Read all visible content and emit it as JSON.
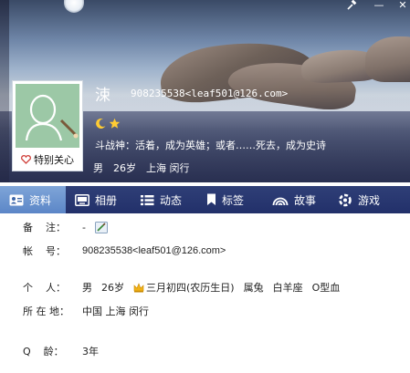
{
  "window": {
    "controls": {
      "tool_icon": "hammer-icon",
      "minimize_label": "—",
      "close_label": "✕"
    }
  },
  "profile": {
    "nickname": "涑",
    "qq_id": "908235538<leaf501@126.com>",
    "care_label": "特别关心",
    "signature": "斗战神：活着，成为英雄；或者……死去，成为史诗",
    "gender": "男",
    "age": "26岁",
    "location": "上海 闵行",
    "level_icons": [
      "moon-icon",
      "star-icon"
    ]
  },
  "tabs": [
    {
      "label": "资料",
      "icon": "profile-card-icon",
      "active": true
    },
    {
      "label": "相册",
      "icon": "album-icon",
      "active": false
    },
    {
      "label": "动态",
      "icon": "feed-list-icon",
      "active": false
    },
    {
      "label": "标签",
      "icon": "bookmark-icon",
      "active": false
    },
    {
      "label": "故事",
      "icon": "story-arc-icon",
      "active": false
    },
    {
      "label": "游戏",
      "icon": "game-icon",
      "active": false
    }
  ],
  "info": {
    "remark_label": "备    注：",
    "remark_value": "-",
    "account_label": "帐    号：",
    "account_value": "908235538<leaf501@126.com>",
    "personal_label": "个    人：",
    "personal_gender": "男",
    "personal_age": "26岁",
    "personal_birthday": "三月初四(农历生日)",
    "personal_zodiac": "属兔",
    "personal_sign": "白羊座",
    "personal_blood": "O型血",
    "location_label": "所 在 地：",
    "location_value": "中国 上海 闵行",
    "qage_label": "Q    龄：",
    "qage_value": "3年"
  }
}
